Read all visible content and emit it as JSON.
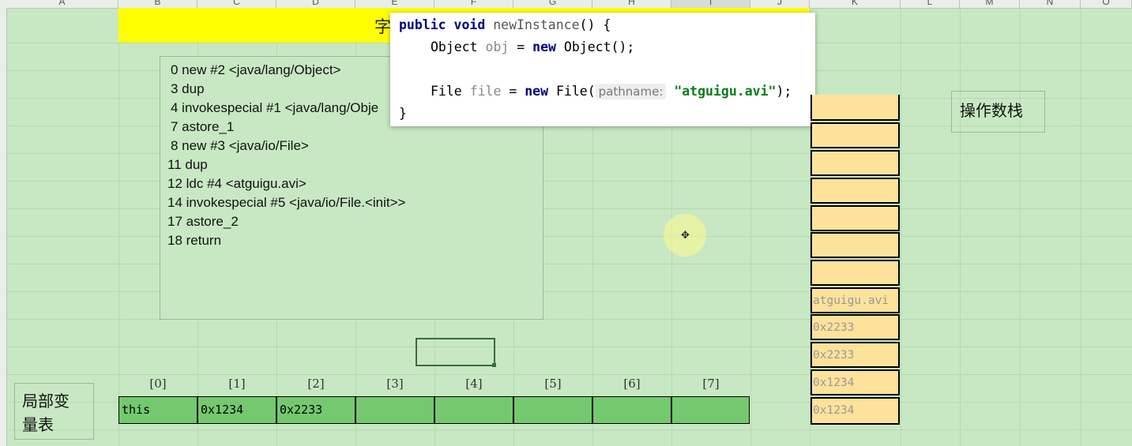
{
  "columns": [
    "A",
    "B",
    "C",
    "D",
    "E",
    "F",
    "G",
    "H",
    "I",
    "J",
    "K",
    "L",
    "M",
    "N",
    "O"
  ],
  "title_char": "字",
  "bytecode": [
    "0 new #2 <java/lang/Object>",
    "3 dup",
    "4 invokespecial #1 <java/lang/Obje",
    "7 astore_1",
    "8 new #3 <java/io/File>",
    "11 dup",
    "12 ldc #4 <atguigu.avi>",
    "14 invokespecial #5 <java/io/File.<init>>",
    "17 astore_2",
    "18 return"
  ],
  "code": {
    "kw_public": "public",
    "kw_void": "void",
    "method": "newInstance",
    "sig_rest": "() {",
    "l2_type": "Object",
    "l2_var": "obj",
    "l2_eq": " = ",
    "kw_new": "new",
    "l2_rest": " Object();",
    "l3_type": "File",
    "l3_var": "file",
    "l3_eq": " = ",
    "l3_call": " File(",
    "l3_hint": "pathname:",
    "l3_str": "\"atguigu.avi\"",
    "l3_end": ");",
    "close": "}"
  },
  "operand_stack": {
    "label": "操作数栈",
    "cells": [
      "",
      "",
      "",
      "",
      "",
      "",
      "",
      "atguigu.avi",
      "0x2233",
      "0x2233",
      "0x1234",
      "0x1234"
    ]
  },
  "local_vars": {
    "label_line1": "局部变",
    "label_line2": "量表",
    "indices": [
      "[0]",
      "[1]",
      "[2]",
      "[3]",
      "[4]",
      "[5]",
      "[6]",
      "[7]"
    ],
    "values": [
      "this",
      "0x1234",
      "0x2233",
      "",
      "",
      "",
      "",
      ""
    ]
  }
}
